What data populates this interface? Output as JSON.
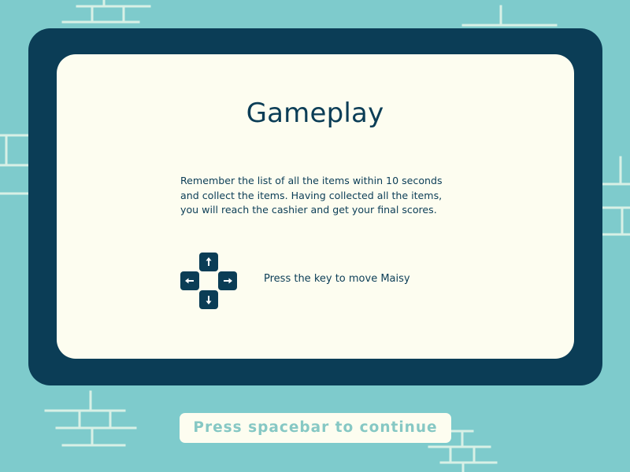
{
  "screen": {
    "title": "Gameplay",
    "description_lines": [
      "Remember the list of all the items within 10 seconds",
      "and collect the items. Having collected all the items,",
      "you will reach the cashier and get your final scores."
    ],
    "controls": {
      "keys": [
        "arrow-up-icon",
        "arrow-left-icon",
        "arrow-right-icon",
        "arrow-down-icon"
      ],
      "hint": "Press the key to move Maisy"
    },
    "continue_label": "Press spacebar to continue"
  },
  "colors": {
    "background": "#7ecbcc",
    "frame": "#0b3d56",
    "panel": "#fdfdf0",
    "brick_lines": "#d8f0e6",
    "continue_text": "#86c8c4"
  }
}
